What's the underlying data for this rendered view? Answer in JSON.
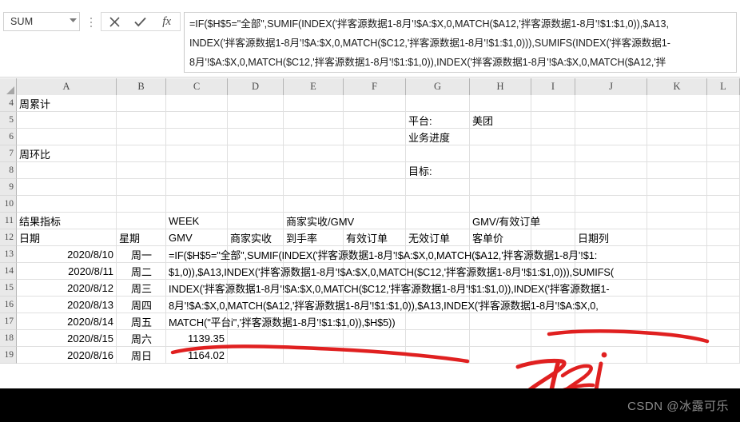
{
  "namebox": {
    "value": "SUM",
    "dropdown_icon": "chevron-down-icon"
  },
  "formula_bar": {
    "cancel_icon": "close-icon",
    "confirm_icon": "check-icon",
    "function_icon": "fx-icon",
    "lines": [
      "=IF($H$5=\"全部\",SUMIF(INDEX('拌客源数据1-8月'!$A:$X,0,MATCH($A12,'拌客源数据1-8月'!$1:$1,0)),$A13,",
      "INDEX('拌客源数据1-8月'!$A:$X,0,MATCH($C12,'拌客源数据1-8月'!$1:$1,0))),SUMIFS(INDEX('拌客源数据1-",
      "8月'!$A:$X,0,MATCH($C12,'拌客源数据1-8月'!$1:$1,0)),INDEX('拌客源数据1-8月'!$A:$X,0,MATCH($A12,'拌"
    ]
  },
  "sheet": {
    "columns": [
      "A",
      "B",
      "C",
      "D",
      "E",
      "F",
      "G",
      "H",
      "I",
      "J",
      "K",
      "L"
    ],
    "rows": [
      "4",
      "5",
      "6",
      "7",
      "8",
      "9",
      "10",
      "11",
      "12",
      "13",
      "14",
      "15",
      "16",
      "17",
      "18",
      "19"
    ],
    "cells": {
      "A4": "周累计",
      "A7": "周环比",
      "G5": "平台:",
      "H5": "美团",
      "G6": "业务进度",
      "G8": "目标:",
      "A11": "结果指标",
      "C11": "WEEK",
      "E11": "商家实收/GMV",
      "H11": "GMV/有效订单",
      "A12": "日期",
      "B12": "星期",
      "C12": "GMV",
      "D12": "商家实收",
      "E12": "到手率",
      "F12": "有效订单",
      "G12": "无效订单",
      "H12": "客单价",
      "J12": "日期列",
      "A13": "2020/8/10",
      "B13": "周一",
      "A14": "2020/8/11",
      "B14": "周二",
      "A15": "2020/8/12",
      "B15": "周三",
      "A16": "2020/8/13",
      "B16": "周四",
      "A17": "2020/8/14",
      "B17": "周五",
      "A18": "2020/8/15",
      "B18": "周六",
      "C18": "1139.35",
      "A19": "2020/8/16",
      "B19": "周日",
      "C19": "1164.02"
    },
    "editing_cell_overflow": [
      "=IF($H$5=\"全部\",SUMIF(INDEX('拌客源数据1-8月'!$A:$X,0,MATCH($A12,'拌客源数据1-8月'!$1:",
      "$1,0)),$A13,INDEX('拌客源数据1-8月'!$A:$X,0,MATCH($C12,'拌客源数据1-8月'!$1:$1,0))),SUMIFS(",
      "INDEX('拌客源数据1-8月'!$A:$X,0,MATCH($C12,'拌客源数据1-8月'!$1:$1,0)),INDEX('拌客源数据1-",
      "8月'!$A:$X,0,MATCH($A12,'拌客源数据1-8月'!$1:$1,0)),$A13,INDEX('拌客源数据1-8月'!$A:$X,0,",
      "MATCH(\"平台i\",'拌客源数据1-8月'!$1:$1,0)),$H$5))"
    ]
  },
  "annotations": {
    "underline_color": "#e02020",
    "handwriting_color": "#e02020"
  },
  "watermark": {
    "text": "CSDN @冰露可乐"
  }
}
